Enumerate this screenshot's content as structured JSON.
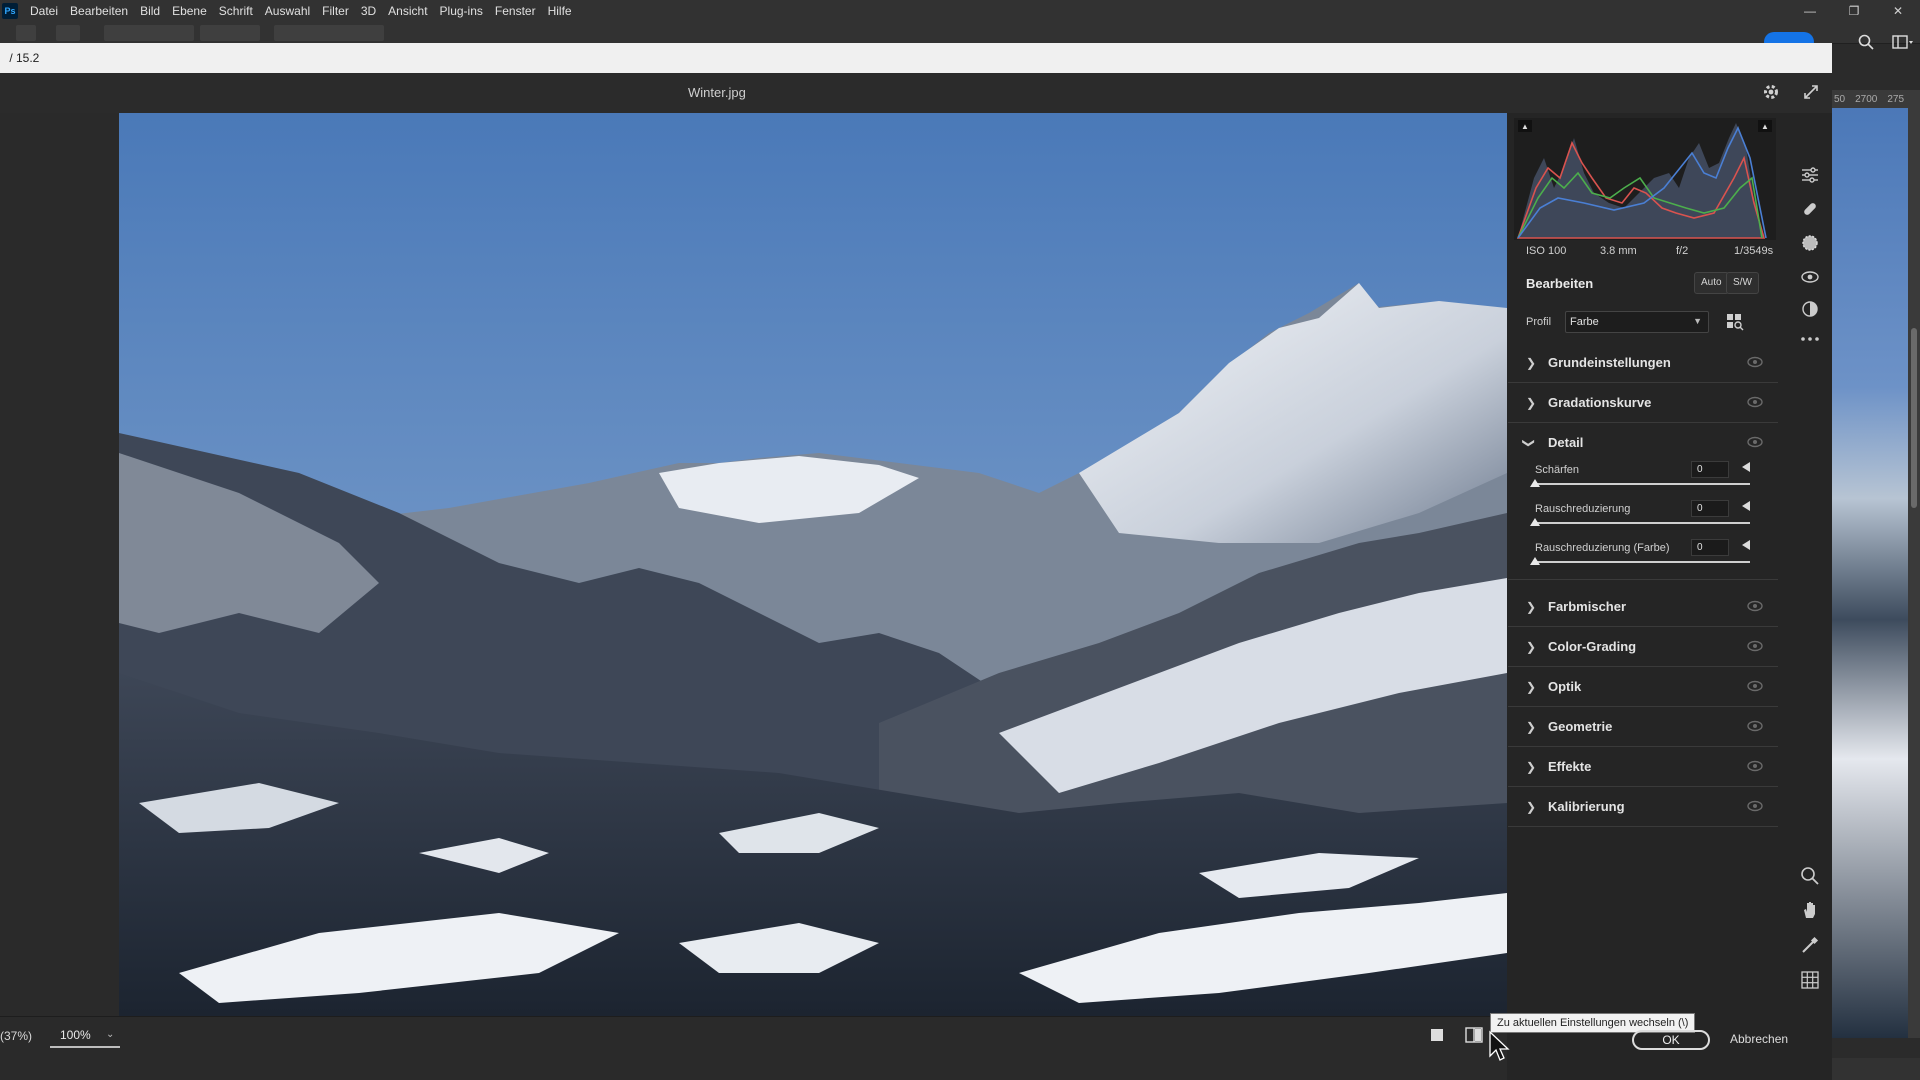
{
  "photoshop": {
    "logo": "Ps",
    "menu": [
      "Datei",
      "Bearbeiten",
      "Bild",
      "Ebene",
      "Schrift",
      "Auswahl",
      "Filter",
      "3D",
      "Ansicht",
      "Plug-ins",
      "Fenster",
      "Hilfe"
    ],
    "ruler_labels": [
      "50",
      "2700",
      "275"
    ]
  },
  "dialog": {
    "title": " / 15.2",
    "filename": "Winter.jpg"
  },
  "bottom": {
    "zoom_fit_label": "(37%)",
    "zoom_value": "100%",
    "tooltip": "Zu aktuellen Einstellungen wechseln (\\)",
    "ok_label": "OK",
    "cancel_label": "Abbrechen"
  },
  "histogram": {
    "iso": "ISO 100",
    "focal": "3.8 mm",
    "aperture": "f/2",
    "shutter": "1/3549s"
  },
  "edit": {
    "heading": "Bearbeiten",
    "auto_label": "Auto",
    "bw_label": "S/W",
    "profile_label": "Profil",
    "profile_value": "Farbe"
  },
  "sections": [
    {
      "title": "Grundeinstellungen",
      "expanded": false
    },
    {
      "title": "Gradationskurve",
      "expanded": false
    },
    {
      "title": "Detail",
      "expanded": true
    },
    {
      "title": "Farbmischer",
      "expanded": false
    },
    {
      "title": "Color-Grading",
      "expanded": false
    },
    {
      "title": "Optik",
      "expanded": false
    },
    {
      "title": "Geometrie",
      "expanded": false
    },
    {
      "title": "Effekte",
      "expanded": false
    },
    {
      "title": "Kalibrierung",
      "expanded": false
    }
  ],
  "detail": {
    "sliders": [
      {
        "label": "Schärfen",
        "value": "0"
      },
      {
        "label": "Rauschreduzierung",
        "value": "0"
      },
      {
        "label": "Rauschreduzierung (Farbe)",
        "value": "0"
      }
    ]
  },
  "colors": {
    "accent": "#1473e6",
    "panel_bg": "#252525",
    "sky": "#4f7fbd"
  }
}
